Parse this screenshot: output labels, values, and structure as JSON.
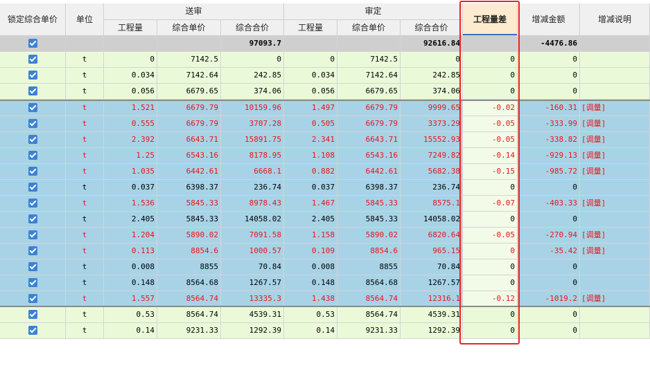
{
  "header": {
    "lock_price": "锁定综合单价",
    "unit": "单位",
    "submitted": "送审",
    "approved": "审定",
    "qty": "工程量",
    "unit_price": "综合单价",
    "total_price": "综合合价",
    "qty_diff": "工程量差",
    "change_amount": "增减金额",
    "change_note": "增减说明"
  },
  "rows": [
    {
      "style": "gray",
      "checked": true,
      "unit": "",
      "s_qty": "",
      "s_price": "",
      "s_total": "97093.7",
      "a_qty": "",
      "a_price": "",
      "a_total": "92616.84",
      "diff": "",
      "amount": "-4476.86",
      "note": "",
      "red": false
    },
    {
      "style": "green",
      "checked": true,
      "unit": "t",
      "s_qty": "0",
      "s_price": "7142.5",
      "s_total": "0",
      "a_qty": "0",
      "a_price": "7142.5",
      "a_total": "0",
      "diff": "0",
      "amount": "0",
      "note": "",
      "red": false
    },
    {
      "style": "green",
      "checked": true,
      "unit": "t",
      "s_qty": "0.034",
      "s_price": "7142.64",
      "s_total": "242.85",
      "a_qty": "0.034",
      "a_price": "7142.64",
      "a_total": "242.85",
      "diff": "0",
      "amount": "0",
      "note": "",
      "red": false
    },
    {
      "style": "green",
      "checked": true,
      "unit": "t",
      "s_qty": "0.056",
      "s_price": "6679.65",
      "s_total": "374.06",
      "a_qty": "0.056",
      "a_price": "6679.65",
      "a_total": "374.06",
      "diff": "0",
      "amount": "0",
      "note": "",
      "red": false
    },
    {
      "style": "blue",
      "checked": true,
      "unit": "t",
      "s_qty": "1.521",
      "s_price": "6679.79",
      "s_total": "10159.96",
      "a_qty": "1.497",
      "a_price": "6679.79",
      "a_total": "9999.65",
      "diff": "-0.02",
      "amount": "-160.31",
      "note": "[调量]",
      "red": true
    },
    {
      "style": "blue",
      "checked": true,
      "unit": "t",
      "s_qty": "0.555",
      "s_price": "6679.79",
      "s_total": "3707.28",
      "a_qty": "0.505",
      "a_price": "6679.79",
      "a_total": "3373.29",
      "diff": "-0.05",
      "amount": "-333.99",
      "note": "[调量]",
      "red": true
    },
    {
      "style": "blue",
      "checked": true,
      "unit": "t",
      "s_qty": "2.392",
      "s_price": "6643.71",
      "s_total": "15891.75",
      "a_qty": "2.341",
      "a_price": "6643.71",
      "a_total": "15552.93",
      "diff": "-0.05",
      "amount": "-338.82",
      "note": "[调量]",
      "red": true
    },
    {
      "style": "blue",
      "checked": true,
      "unit": "t",
      "s_qty": "1.25",
      "s_price": "6543.16",
      "s_total": "8178.95",
      "a_qty": "1.108",
      "a_price": "6543.16",
      "a_total": "7249.82",
      "diff": "-0.14",
      "amount": "-929.13",
      "note": "[调量]",
      "red": true
    },
    {
      "style": "blue",
      "checked": true,
      "unit": "t",
      "s_qty": "1.035",
      "s_price": "6442.61",
      "s_total": "6668.1",
      "a_qty": "0.882",
      "a_price": "6442.61",
      "a_total": "5682.38",
      "diff": "-0.15",
      "amount": "-985.72",
      "note": "[调量]",
      "red": true
    },
    {
      "style": "blue",
      "checked": true,
      "unit": "t",
      "s_qty": "0.037",
      "s_price": "6398.37",
      "s_total": "236.74",
      "a_qty": "0.037",
      "a_price": "6398.37",
      "a_total": "236.74",
      "diff": "0",
      "amount": "0",
      "note": "",
      "red": false
    },
    {
      "style": "blue",
      "checked": true,
      "unit": "t",
      "s_qty": "1.536",
      "s_price": "5845.33",
      "s_total": "8978.43",
      "a_qty": "1.467",
      "a_price": "5845.33",
      "a_total": "8575.1",
      "diff": "-0.07",
      "amount": "-403.33",
      "note": "[调量]",
      "red": true
    },
    {
      "style": "blue",
      "checked": true,
      "unit": "t",
      "s_qty": "2.405",
      "s_price": "5845.33",
      "s_total": "14058.02",
      "a_qty": "2.405",
      "a_price": "5845.33",
      "a_total": "14058.02",
      "diff": "0",
      "amount": "0",
      "note": "",
      "red": false
    },
    {
      "style": "blue",
      "checked": true,
      "unit": "t",
      "s_qty": "1.204",
      "s_price": "5890.02",
      "s_total": "7091.58",
      "a_qty": "1.158",
      "a_price": "5890.02",
      "a_total": "6820.64",
      "diff": "-0.05",
      "amount": "-270.94",
      "note": "[调量]",
      "red": true
    },
    {
      "style": "blue",
      "checked": true,
      "unit": "t",
      "s_qty": "0.113",
      "s_price": "8854.6",
      "s_total": "1000.57",
      "a_qty": "0.109",
      "a_price": "8854.6",
      "a_total": "965.15",
      "diff": "0",
      "amount": "-35.42",
      "note": "[调量]",
      "red": true
    },
    {
      "style": "blue",
      "checked": true,
      "unit": "t",
      "s_qty": "0.008",
      "s_price": "8855",
      "s_total": "70.84",
      "a_qty": "0.008",
      "a_price": "8855",
      "a_total": "70.84",
      "diff": "0",
      "amount": "0",
      "note": "",
      "red": false
    },
    {
      "style": "blue",
      "checked": true,
      "unit": "t",
      "s_qty": "0.148",
      "s_price": "8564.68",
      "s_total": "1267.57",
      "a_qty": "0.148",
      "a_price": "8564.68",
      "a_total": "1267.57",
      "diff": "0",
      "amount": "0",
      "note": "",
      "red": false
    },
    {
      "style": "blue",
      "checked": true,
      "unit": "t",
      "s_qty": "1.557",
      "s_price": "8564.74",
      "s_total": "13335.3",
      "a_qty": "1.438",
      "a_price": "8564.74",
      "a_total": "12316.1",
      "diff": "-0.12",
      "amount": "-1019.2",
      "note": "[调量]",
      "red": true
    },
    {
      "style": "green",
      "checked": true,
      "unit": "t",
      "s_qty": "0.53",
      "s_price": "8564.74",
      "s_total": "4539.31",
      "a_qty": "0.53",
      "a_price": "8564.74",
      "a_total": "4539.31",
      "diff": "0",
      "amount": "0",
      "note": "",
      "red": false
    },
    {
      "style": "green",
      "checked": true,
      "unit": "t",
      "s_qty": "0.14",
      "s_price": "9231.33",
      "s_total": "1292.39",
      "a_qty": "0.14",
      "a_price": "9231.33",
      "a_total": "1292.39",
      "diff": "0",
      "amount": "0",
      "note": "",
      "red": false
    }
  ],
  "colors": {
    "header_bg": "#f0f0f0",
    "selected_header_bg": "#fdebd0",
    "row_green": "#eafad9",
    "row_blue": "#a8d3e6",
    "row_gray": "#cfcfcf",
    "red_text": "#e8141b",
    "checkbox": "#3a82d8",
    "highlight_frame": "#ee2222"
  }
}
